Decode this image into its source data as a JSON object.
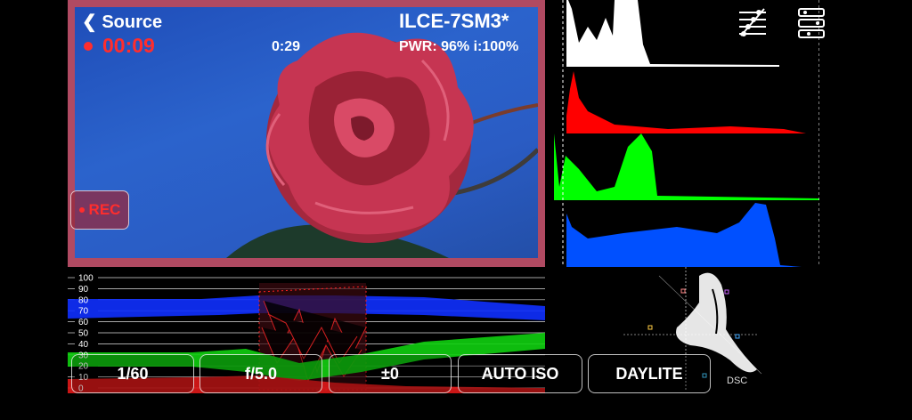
{
  "header": {
    "source_label": "Source",
    "timer": "00:09",
    "clip_remaining": "0:29",
    "camera_name": "ILCE-7SM3*",
    "power_status": "PWR: 96% i:100%"
  },
  "record_button": {
    "label": "REC"
  },
  "controls": {
    "shutter": "1/60",
    "aperture": "f/5.0",
    "exposure_comp": "±0",
    "iso": "AUTO ISO",
    "white_balance": "DAYLITE"
  },
  "waveform": {
    "scale_labels": [
      "100",
      "90",
      "80",
      "70",
      "60",
      "50",
      "40",
      "30",
      "20",
      "10",
      "0"
    ]
  },
  "vectorscope": {
    "label": "DSC"
  },
  "icons": {
    "settings": "sliders-icon",
    "layout": "layout-toggle-icon"
  },
  "colors": {
    "record_red": "#ff2d2d",
    "preview_border": "#b04a62"
  }
}
